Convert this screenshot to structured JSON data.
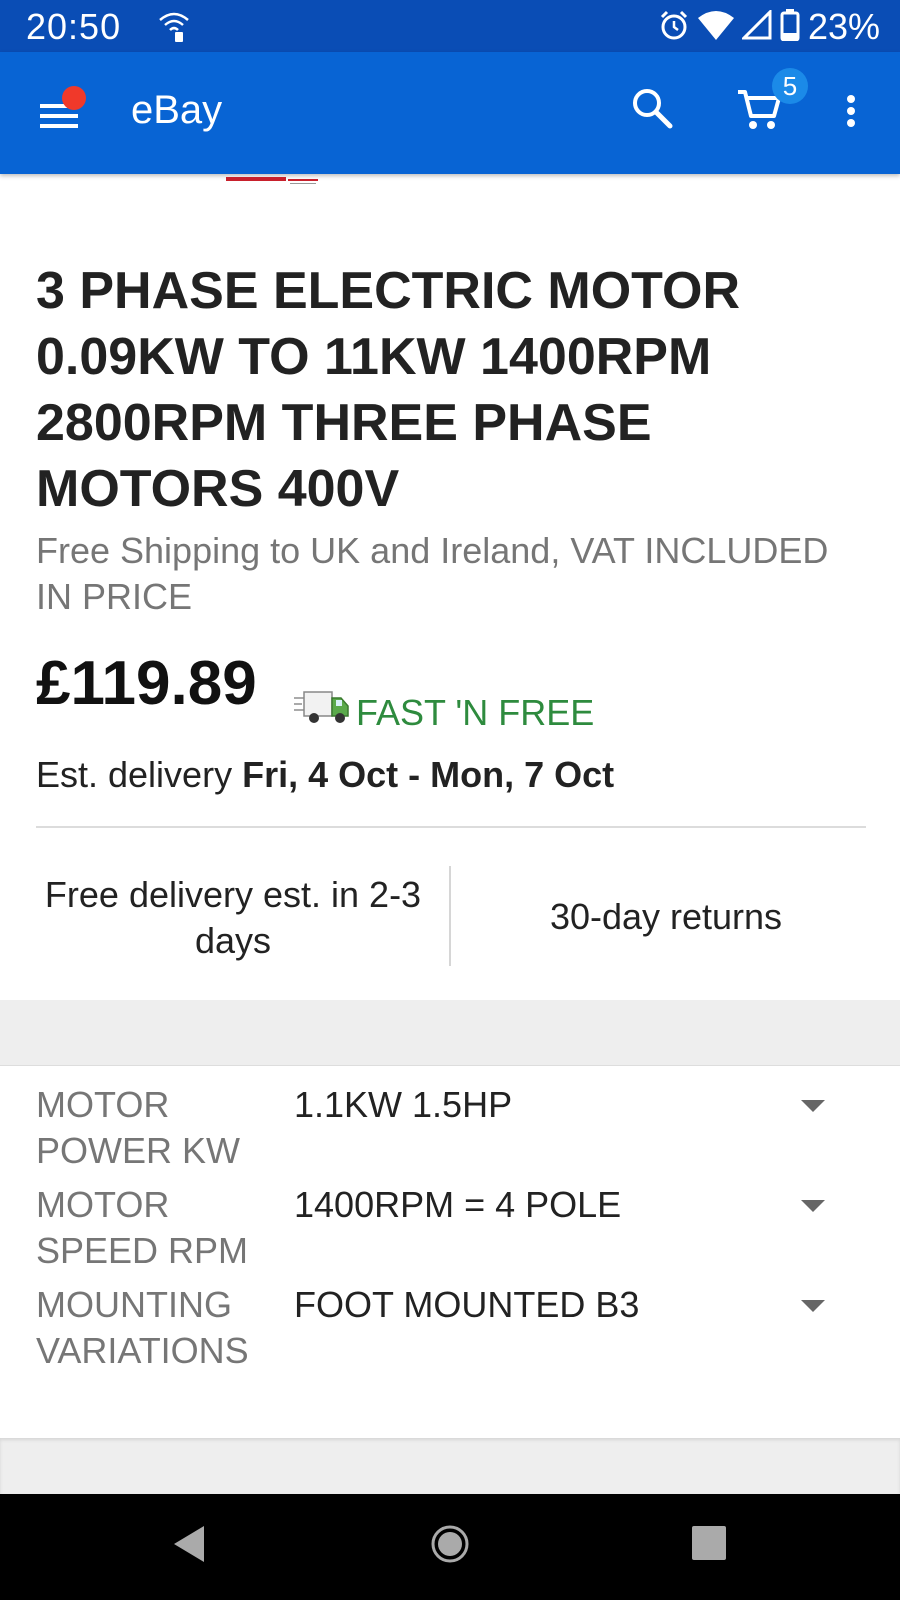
{
  "status_bar": {
    "time": "20:50",
    "battery_percent": "23%",
    "icons": [
      "wifi-calling-icon",
      "alarm-icon",
      "wifi-icon",
      "signal-icon",
      "battery-icon"
    ]
  },
  "app_bar": {
    "title": "eBay",
    "cart_count": "5",
    "colors": {
      "bar": "#0864d4",
      "status": "#0a4db5",
      "notification_dot": "#f0392a",
      "badge": "#1b8ae8"
    }
  },
  "listing": {
    "title": "3 PHASE ELECTRIC MOTOR 0.09KW TO 11KW 1400RPM 2800RPM THREE PHASE MOTORS 400V",
    "subtitle": "Free Shipping to UK and Ireland, VAT INCLUDED IN PRICE",
    "price": "£119.89",
    "shipping_badge": "FAST 'N FREE",
    "est_delivery_label": "Est. delivery",
    "est_delivery_dates": "Fri, 4 Oct - Mon, 7 Oct",
    "free_delivery": "Free delivery est. in 2-3 days",
    "returns": "30-day returns",
    "accent_green": "#2e8b3e"
  },
  "variations": [
    {
      "label": "MOTOR POWER KW",
      "value": "1.1KW 1.5HP"
    },
    {
      "label": "MOTOR SPEED RPM",
      "value": "1400RPM = 4 POLE"
    },
    {
      "label": "MOUNTING VARIATIONS",
      "value": "FOOT MOUNTED B3"
    }
  ]
}
